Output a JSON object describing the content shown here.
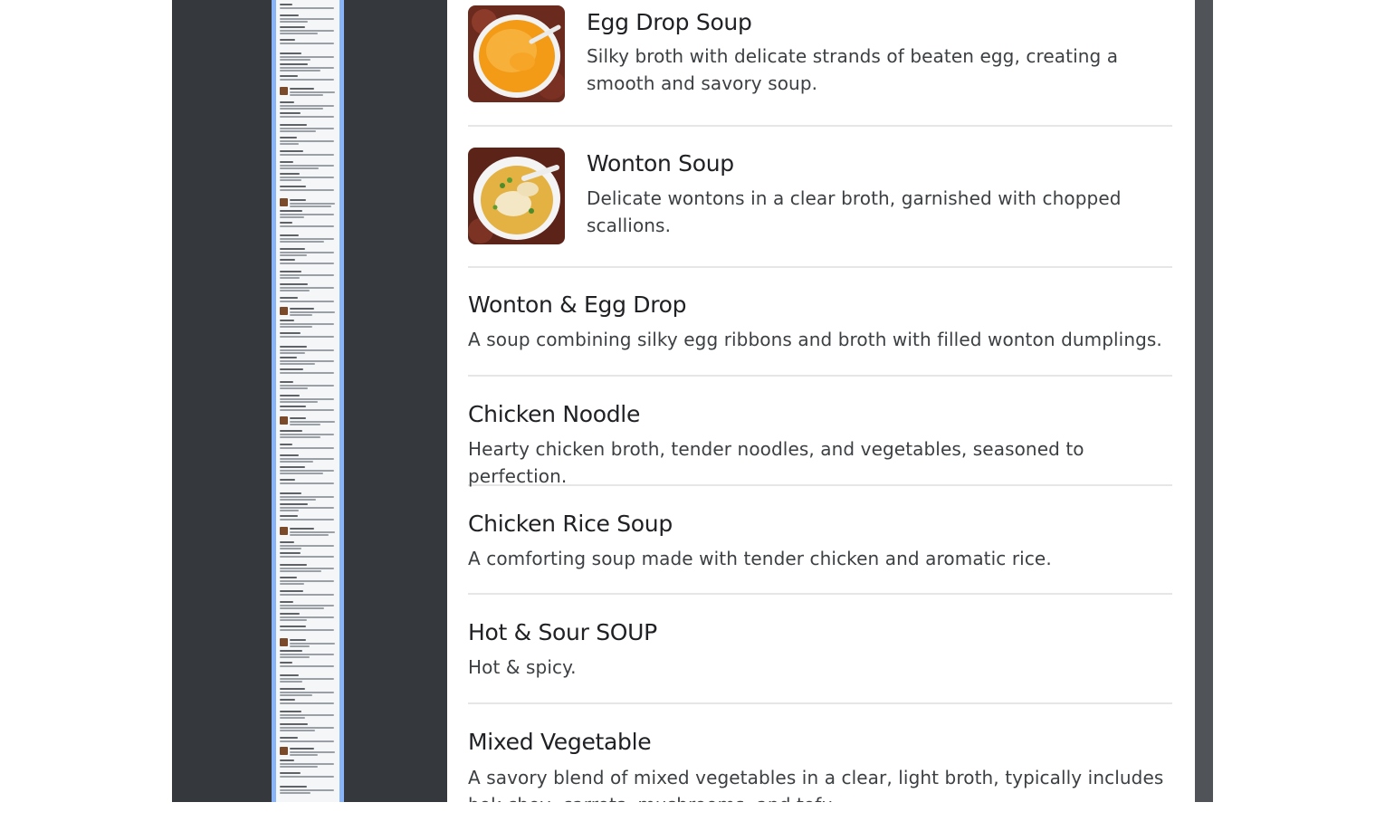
{
  "menu": {
    "items": [
      {
        "name": "Egg Drop Soup",
        "description": "Silky broth with delicate strands of beaten egg, creating a smooth and savory soup.",
        "image": "egg-drop-soup-photo"
      },
      {
        "name": "Wonton Soup",
        "description": "Delicate wontons in a clear broth, garnished with chopped scallions.",
        "image": "wonton-soup-photo"
      },
      {
        "name": "Wonton & Egg Drop",
        "description": "A soup combining silky egg ribbons and broth with filled wonton dumplings."
      },
      {
        "name": "Chicken Noodle",
        "description": "Hearty chicken broth, tender noodles, and vegetables, seasoned to perfection."
      },
      {
        "name": "Chicken Rice Soup",
        "description": "A comforting soup made with tender chicken and aromatic rice."
      },
      {
        "name": "Hot & Sour SOUP",
        "description": "Hot & spicy."
      },
      {
        "name": "Mixed Vegetable",
        "description": "A savory blend of mixed vegetables in a clear, light broth, typically includes bok choy, carrots, mushrooms, and tofu."
      }
    ]
  },
  "colors": {
    "viewer_background": "#35383c",
    "thumbnail_highlight": "#8ab4f8",
    "page_background": "#ffffff",
    "divider": "#e6e6e6"
  }
}
